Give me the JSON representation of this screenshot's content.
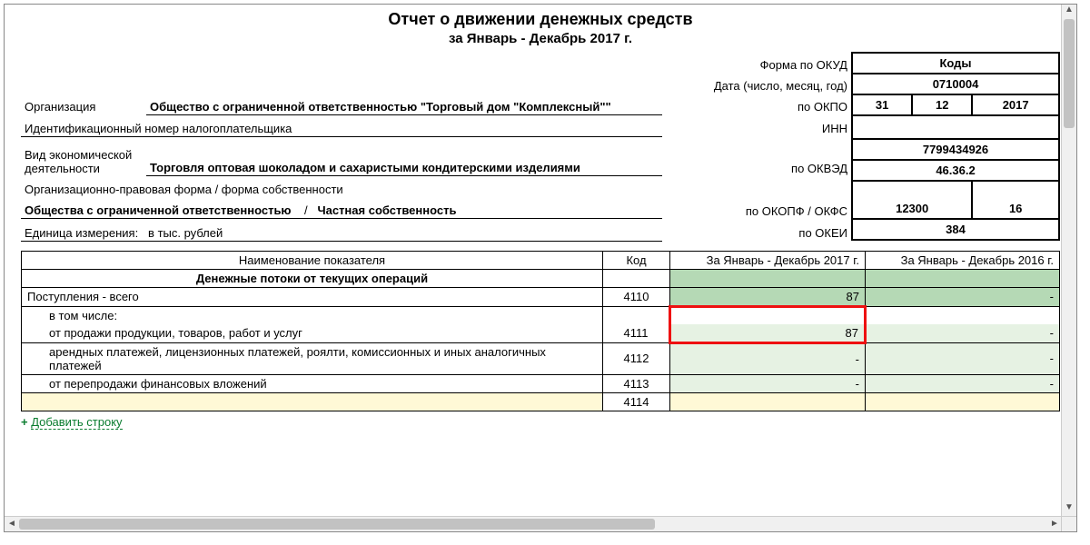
{
  "title": "Отчет о движении денежных средств",
  "subtitle": "за Январь - Декабрь 2017 г.",
  "codes_header": "Коды",
  "header_rows": {
    "form_okud_label": "Форма по ОКУД",
    "form_okud": "0710004",
    "date_label": "Дата (число, месяц, год)",
    "date_day": "31",
    "date_month": "12",
    "date_year": "2017",
    "okpo_label": "по ОКПО",
    "okpo": "",
    "inn_label": "ИНН",
    "inn": "7799434926",
    "okved_label": "по ОКВЭД",
    "okved": "46.36.2",
    "okopf_okfs_label": "по ОКОПФ / ОКФС",
    "okopf": "12300",
    "okfs": "16",
    "okei_label": "по ОКЕИ",
    "okei": "384"
  },
  "org_label": "Организация",
  "org_value": "Общество с ограниченной ответственностью \"Торговый дом \"Комплексный\"\"",
  "inn_line_label": "Идентификационный номер налогоплательщика",
  "activity_label": "Вид экономической деятельности",
  "activity_value": "Торговля оптовая шоколадом и сахаристыми кондитерскими изделиями",
  "legal_form_label": "Организационно-правовая форма / форма собственности",
  "legal_form1": "Общества с ограниченной ответственностью",
  "legal_form_sep": "/",
  "legal_form2": "Частная собственность",
  "unit_label": "Единица измерения:",
  "unit_value": "в тыс. рублей",
  "table": {
    "col_name": "Наименование показателя",
    "col_code": "Код",
    "col_period_cur": "За Январь - Декабрь 2017 г.",
    "col_period_prev": "За Январь - Декабрь 2016 г.",
    "section": "Денежные потоки от текущих операций",
    "rows": [
      {
        "name": "Поступления - всего",
        "code": "4110",
        "cur": "87",
        "prev": "-",
        "cell_cur_class": "cell-green-dark",
        "cell_prev_class": "cell-green-dark",
        "name_class": ""
      },
      {
        "name": "в том числе:",
        "code": "",
        "cur": "",
        "prev": "",
        "cell_cur_class": "highlight-red",
        "cell_prev_class": "",
        "name_class": "indent1"
      },
      {
        "name": "от продажи продукции, товаров, работ и услуг",
        "code": "4111",
        "cur": "87",
        "prev": "-",
        "cell_cur_class": "cell-green-light highlight-red",
        "cell_prev_class": "cell-green-light",
        "name_class": "indent2"
      },
      {
        "name": "арендных платежей, лицензионных платежей, роялти, комиссионных и иных аналогичных платежей",
        "code": "4112",
        "cur": "-",
        "prev": "-",
        "cell_cur_class": "cell-green-light",
        "cell_prev_class": "cell-green-light",
        "name_class": "indent2"
      },
      {
        "name": "от перепродажи финансовых вложений",
        "code": "4113",
        "cur": "-",
        "prev": "-",
        "cell_cur_class": "cell-green-light",
        "cell_prev_class": "cell-green-light",
        "name_class": "indent2"
      },
      {
        "name": "",
        "code": "4114",
        "cur": "",
        "prev": "",
        "cell_cur_class": "cell-yellow",
        "cell_prev_class": "cell-yellow",
        "name_class": "indent2 cell-yellow"
      }
    ]
  },
  "add_row_label": "Добавить строку"
}
